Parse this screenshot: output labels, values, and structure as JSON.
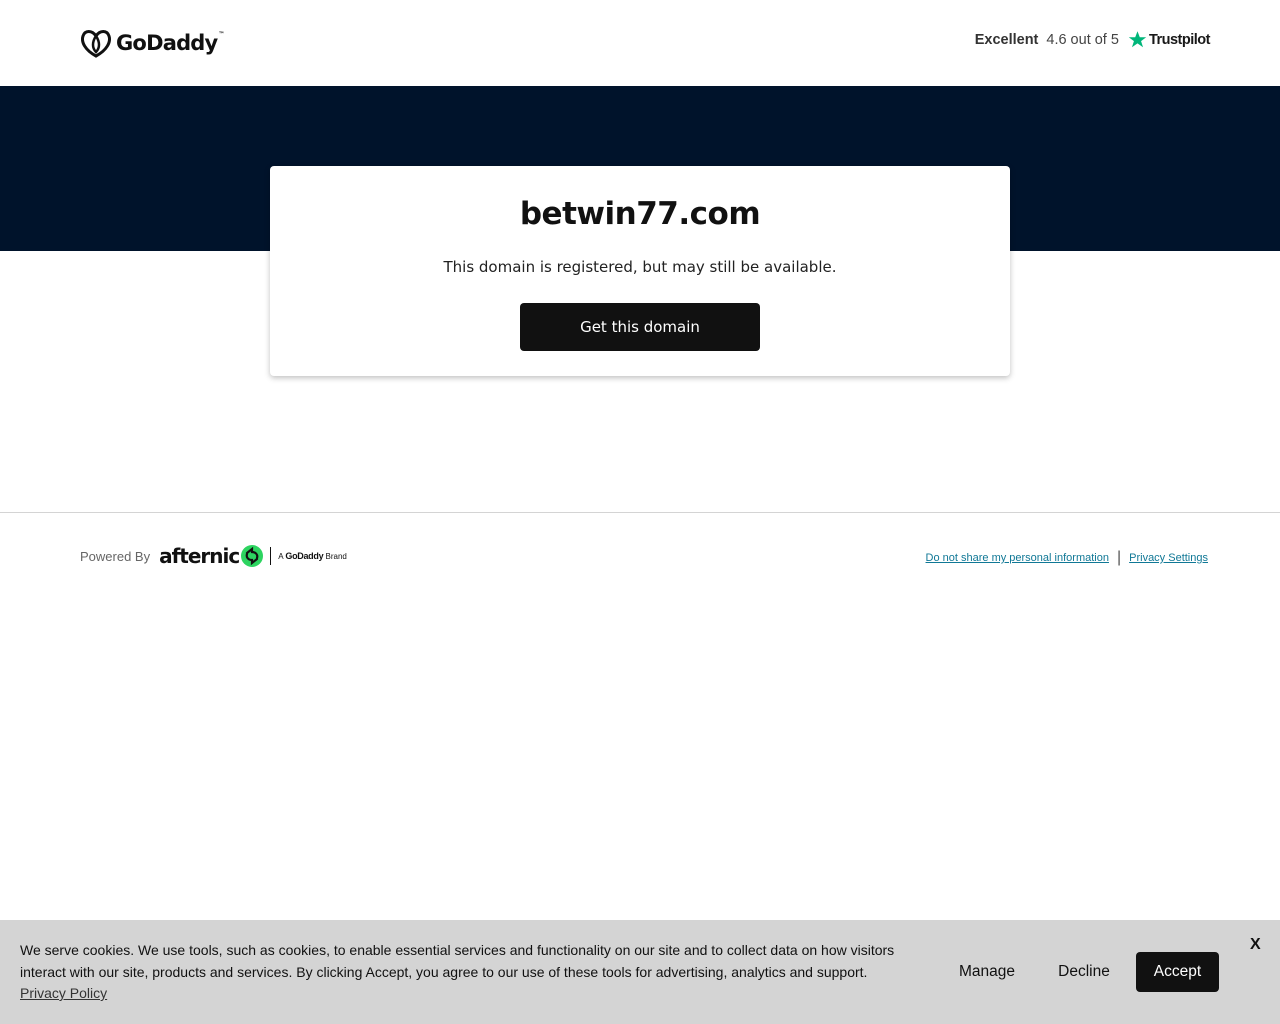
{
  "header": {
    "logo_text": "GoDaddy",
    "logo_tm": "™",
    "rating_label": "Excellent",
    "rating_score": "4.6 out of 5",
    "trustpilot": "Trustpilot"
  },
  "card": {
    "domain": "betwin77.com",
    "subtitle": "This domain is registered, but may still be available.",
    "cta_label": "Get this domain"
  },
  "footer": {
    "powered_by": "Powered By",
    "afternic": "afternic",
    "brand_prefix": "A",
    "brand_name": "GoDaddy",
    "brand_suffix": "Brand",
    "link_do_not_share": "Do not share my personal information",
    "link_separator": "|",
    "link_privacy": "Privacy Settings"
  },
  "cookie": {
    "text": "We serve cookies. We use tools, such as cookies, to enable essential services and functionality on our site and to collect data on how visitors interact with our site, products and services. By clicking Accept, you agree to our use of these tools for advertising, analytics and support.",
    "policy_link": "Privacy Policy",
    "manage": "Manage",
    "decline": "Decline",
    "accept": "Accept",
    "close": "X"
  },
  "colors": {
    "hero_bg": "#00132b",
    "button_bg": "#111111",
    "trustpilot_green": "#00b67a",
    "afternic_green": "#2dd460",
    "link_color": "#107896",
    "cookie_bg": "#d4d4d4"
  },
  "icons": [
    "godaddy-logo-icon",
    "trustpilot-star-icon",
    "afternic-logo-icon",
    "close-icon"
  ]
}
